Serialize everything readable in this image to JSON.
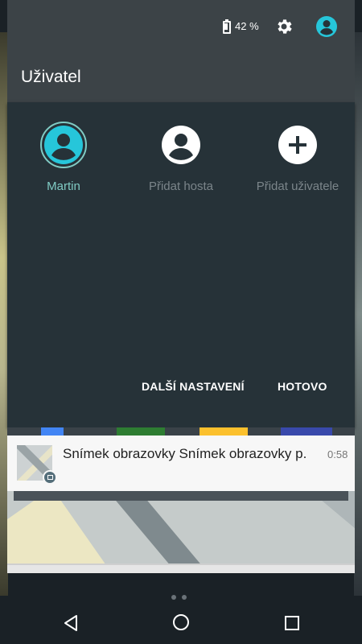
{
  "status_bar": {
    "battery_percent": "42 %"
  },
  "quick_settings": {
    "title": "Uživatel"
  },
  "users": [
    {
      "label": "Martin",
      "active": true
    },
    {
      "label": "Přidat hosta",
      "active": false
    },
    {
      "label": "Přidat uživatele",
      "active": false
    }
  ],
  "actions": {
    "more_settings": "DALŠÍ NASTAVENÍ",
    "done": "HOTOVO"
  },
  "notification": {
    "text": "Snímek obrazovky Snímek obrazovky p.",
    "time": "0:58",
    "icon": "image-icon"
  },
  "colors": {
    "accent": "#80cbc4",
    "avatar": "#26c6da",
    "panel": "#263238",
    "header": "#3c4347"
  }
}
